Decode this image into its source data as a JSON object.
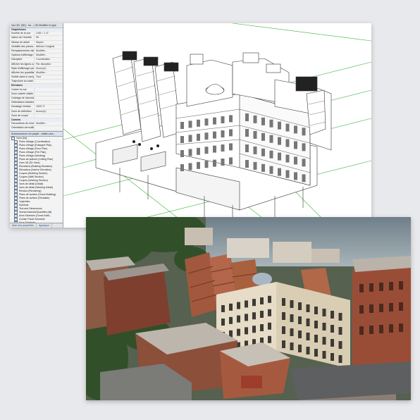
{
  "properties_panel": {
    "header": "Vue 3D: {3D} - for... | 3D Modifier le type",
    "sections": [
      {
        "label": "Graphismes",
        "rows": [
          {
            "key": "Echelle de la vue",
            "value": "1/48 = 1'-0\""
          },
          {
            "key": "Valeur de l'échelle",
            "value": "96"
          },
          {
            "key": "Niveau de détail",
            "value": "Moyen"
          },
          {
            "key": "Visibilité des pièces",
            "value": "Afficher l'original"
          },
          {
            "key": "Remplacements visibilité/graphisme",
            "value": "Modifier..."
          },
          {
            "key": "Options d'affichage des graphismes",
            "value": "Modifier..."
          },
          {
            "key": "Discipline",
            "value": "Coordination"
          },
          {
            "key": "Afficher les lignes cachées",
            "value": "Par discipline"
          },
          {
            "key": "Style d'affichage par défaut",
            "value": "Aucun(e)"
          },
          {
            "key": "Afficher les quadrillages",
            "value": "Modifier..."
          },
          {
            "key": "Visible dans le navigateur",
            "value": "Tout"
          },
          {
            "key": "Trajectoire du soleil",
            "value": ""
          }
        ]
      },
      {
        "label": "Etendues",
        "rows": [
          {
            "key": "Cadrer la vue",
            "value": ""
          },
          {
            "key": "Zone cadrée visible",
            "value": ""
          },
          {
            "key": "Cadrage de l'annotation",
            "value": ""
          },
          {
            "key": "Délimitation lointaine",
            "value": ""
          },
          {
            "key": "Décalage lointain",
            "value": "1000' 0\""
          },
          {
            "key": "Zone de définition",
            "value": "Aucun(e)"
          },
          {
            "key": "Zone de coupe",
            "value": ""
          }
        ]
      },
      {
        "label": "Caméra",
        "rows": [
          {
            "key": "Paramètres de rendu",
            "value": "Modifier..."
          },
          {
            "key": "Orientation verrouillée",
            "value": ""
          }
        ]
      }
    ]
  },
  "project_browser": {
    "header": "Arborescence du projet - ballen-ma...",
    "items": [
      "Vues (fra)",
      "Plans d'étage (Coordination)",
      "Plans d'étage (Enlarged Plan)",
      "Plans d'étage (Floor Plan)",
      "Plans d'étage (Fire Plan)",
      "Plans d'étage (Working)",
      "Plans de plafond (Ceiling Plan)",
      "Vues 3D (3D View)",
      "Elévations (Building Elevation)",
      "Elévations (Interior Elevation)",
      "Coupes (Building Section)",
      "Coupes (Wall Section)",
      "Coupes (Working Section)",
      "Vues de détail (Detail)",
      "Vues de détail (Working Detail)",
      "Rendus (Rendering)",
      "Plans de surface (Gross Building)",
      "Plans de surface (Rentable)",
      "Légendes",
      "Symbols",
      "Text and Dimensions",
      "Nomenclatures/Quantités (all)",
      "Area Schedule (Gross Build...",
      "Curtain Panel Schedule",
      "Door Schedule",
      "Multi-Category Schedule",
      "Room Finish Schedule",
      "Sheet List",
      "Solar Panel Schedule",
      "Wall Schedule"
    ]
  },
  "bottom_tabs": [
    "Aide des propriétés",
    "Appliquer"
  ],
  "icons": {
    "tree_item": "view-icon",
    "render": "rendered-photo-image",
    "model": "3d-model-view"
  },
  "colors": {
    "panel_bg": "#f3f3f3",
    "grid_line": "#3cb43c",
    "page_bg": "#e8e9ec"
  }
}
